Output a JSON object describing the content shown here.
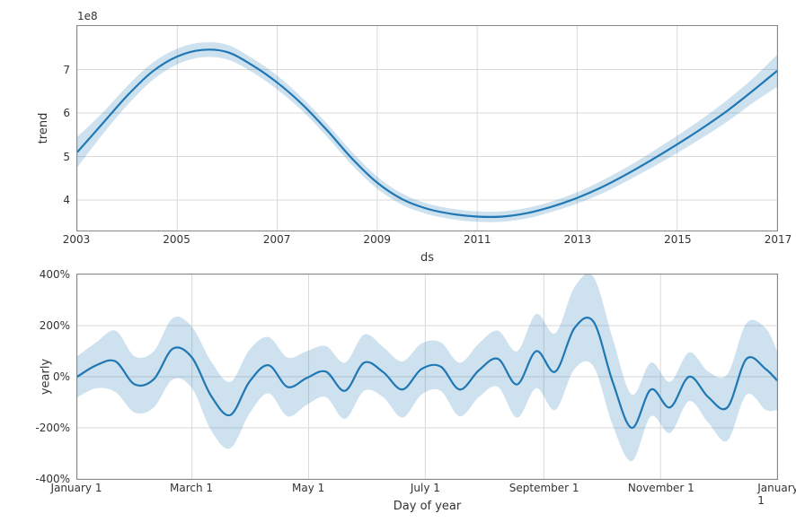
{
  "chart_data": [
    {
      "type": "line",
      "title": "",
      "xlabel": "ds",
      "ylabel": "trend",
      "y_multiplier_label": "1e8",
      "xlim": [
        2003,
        2017
      ],
      "ylim": [
        3.3,
        8.0
      ],
      "xticks": [
        2003,
        2005,
        2007,
        2009,
        2011,
        2013,
        2015,
        2017
      ],
      "yticks": [
        4,
        5,
        6,
        7
      ],
      "x": [
        2003.0,
        2003.5,
        2004.0,
        2004.5,
        2005.0,
        2005.5,
        2006.0,
        2006.5,
        2007.0,
        2007.5,
        2008.0,
        2008.5,
        2009.0,
        2009.5,
        2010.0,
        2010.5,
        2011.0,
        2011.5,
        2012.0,
        2012.5,
        2013.0,
        2013.5,
        2014.0,
        2014.5,
        2015.0,
        2015.5,
        2016.0,
        2016.5,
        2017.0
      ],
      "values": [
        5.1,
        5.75,
        6.4,
        6.95,
        7.3,
        7.45,
        7.4,
        7.1,
        6.7,
        6.2,
        5.6,
        4.95,
        4.4,
        4.02,
        3.8,
        3.68,
        3.62,
        3.62,
        3.7,
        3.85,
        4.05,
        4.3,
        4.6,
        4.93,
        5.28,
        5.65,
        6.05,
        6.5,
        6.97
      ],
      "lower": [
        4.75,
        5.5,
        6.18,
        6.75,
        7.12,
        7.28,
        7.23,
        6.94,
        6.54,
        6.05,
        5.45,
        4.8,
        4.26,
        3.89,
        3.68,
        3.56,
        3.5,
        3.5,
        3.58,
        3.73,
        3.92,
        4.15,
        4.44,
        4.75,
        5.08,
        5.43,
        5.8,
        6.22,
        6.6
      ],
      "upper": [
        5.45,
        6.0,
        6.62,
        7.15,
        7.48,
        7.62,
        7.57,
        7.26,
        6.86,
        6.35,
        5.75,
        5.1,
        4.54,
        4.15,
        3.92,
        3.8,
        3.74,
        3.74,
        3.82,
        3.97,
        4.18,
        4.45,
        4.76,
        5.11,
        5.48,
        5.87,
        6.3,
        6.78,
        7.34
      ]
    },
    {
      "type": "line",
      "title": "",
      "xlabel": "Day of year",
      "ylabel": "yearly",
      "xlim": [
        0,
        366
      ],
      "ylim": [
        -400,
        400
      ],
      "xticks": [
        0,
        60,
        121,
        182,
        244,
        305,
        366
      ],
      "xtick_labels": [
        "January 1",
        "March 1",
        "May 1",
        "July 1",
        "September 1",
        "November 1",
        "January 1"
      ],
      "yticks": [
        -400,
        -200,
        0,
        200,
        400
      ],
      "ytick_labels": [
        "-400%",
        "-200%",
        "0%",
        "200%",
        "400%"
      ],
      "x": [
        0,
        10,
        20,
        30,
        40,
        50,
        60,
        70,
        80,
        90,
        100,
        110,
        120,
        130,
        140,
        150,
        160,
        170,
        180,
        190,
        200,
        210,
        220,
        230,
        240,
        250,
        260,
        270,
        280,
        290,
        300,
        310,
        320,
        330,
        340,
        350,
        360,
        366
      ],
      "values": [
        0,
        45,
        60,
        -30,
        -10,
        110,
        75,
        -75,
        -150,
        -20,
        45,
        -40,
        -5,
        20,
        -55,
        55,
        18,
        -50,
        30,
        40,
        -50,
        25,
        70,
        -30,
        100,
        20,
        190,
        215,
        -20,
        -200,
        -50,
        -120,
        0,
        -80,
        -120,
        70,
        30,
        -15
      ],
      "lower": [
        -80,
        -45,
        -60,
        -140,
        -120,
        -10,
        -45,
        -210,
        -280,
        -145,
        -65,
        -155,
        -110,
        -80,
        -165,
        -55,
        -80,
        -160,
        -70,
        -55,
        -155,
        -80,
        -40,
        -160,
        -45,
        -130,
        30,
        40,
        -190,
        -330,
        -155,
        -220,
        -95,
        -180,
        -250,
        -70,
        -130,
        -130
      ],
      "upper": [
        80,
        135,
        180,
        80,
        100,
        230,
        195,
        60,
        -20,
        105,
        155,
        75,
        100,
        120,
        55,
        165,
        116,
        60,
        130,
        135,
        55,
        130,
        180,
        100,
        245,
        170,
        350,
        390,
        150,
        -70,
        55,
        -20,
        95,
        20,
        10,
        210,
        190,
        100
      ]
    }
  ]
}
